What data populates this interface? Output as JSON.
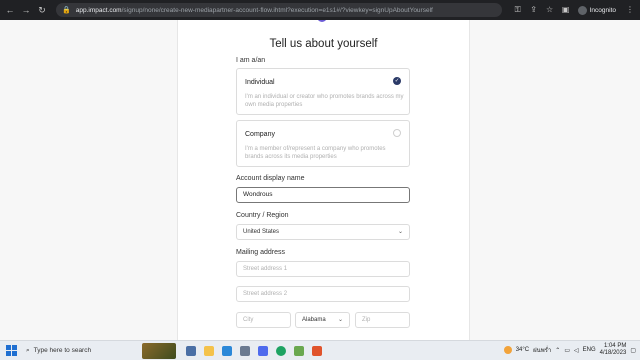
{
  "browser": {
    "url_host": "app.impact.com",
    "url_path": "/signup/none/create-new-mediapartner-account-flow.ihtml?execution=e1s1#/?viewkey=signUpAboutYourself",
    "profile_label": "Incognito"
  },
  "form": {
    "title": "Tell us about yourself",
    "i_am_label": "I am a/an",
    "options": [
      {
        "title": "Individual",
        "desc": "I'm an individual or creator who promotes brands across my own media properties",
        "selected": true
      },
      {
        "title": "Company",
        "desc": "I'm a member of/represent a company who promotes brands across its media properties",
        "selected": false
      }
    ],
    "display_name_label": "Account display name",
    "display_name_value": "Wondrous",
    "country_label": "Country / Region",
    "country_value": "United States",
    "mailing_label": "Mailing address",
    "street1_placeholder": "Street address 1",
    "street2_placeholder": "Street address 2",
    "city_placeholder": "City",
    "state_value": "Alabama",
    "zip_placeholder": "Zip"
  },
  "taskbar": {
    "search_text": "Type here to search",
    "weather": "34°C",
    "weather_desc": "ฝนพร่ำ",
    "lang": "ENG",
    "time": "1:04 PM",
    "date": "4/18/2023"
  }
}
